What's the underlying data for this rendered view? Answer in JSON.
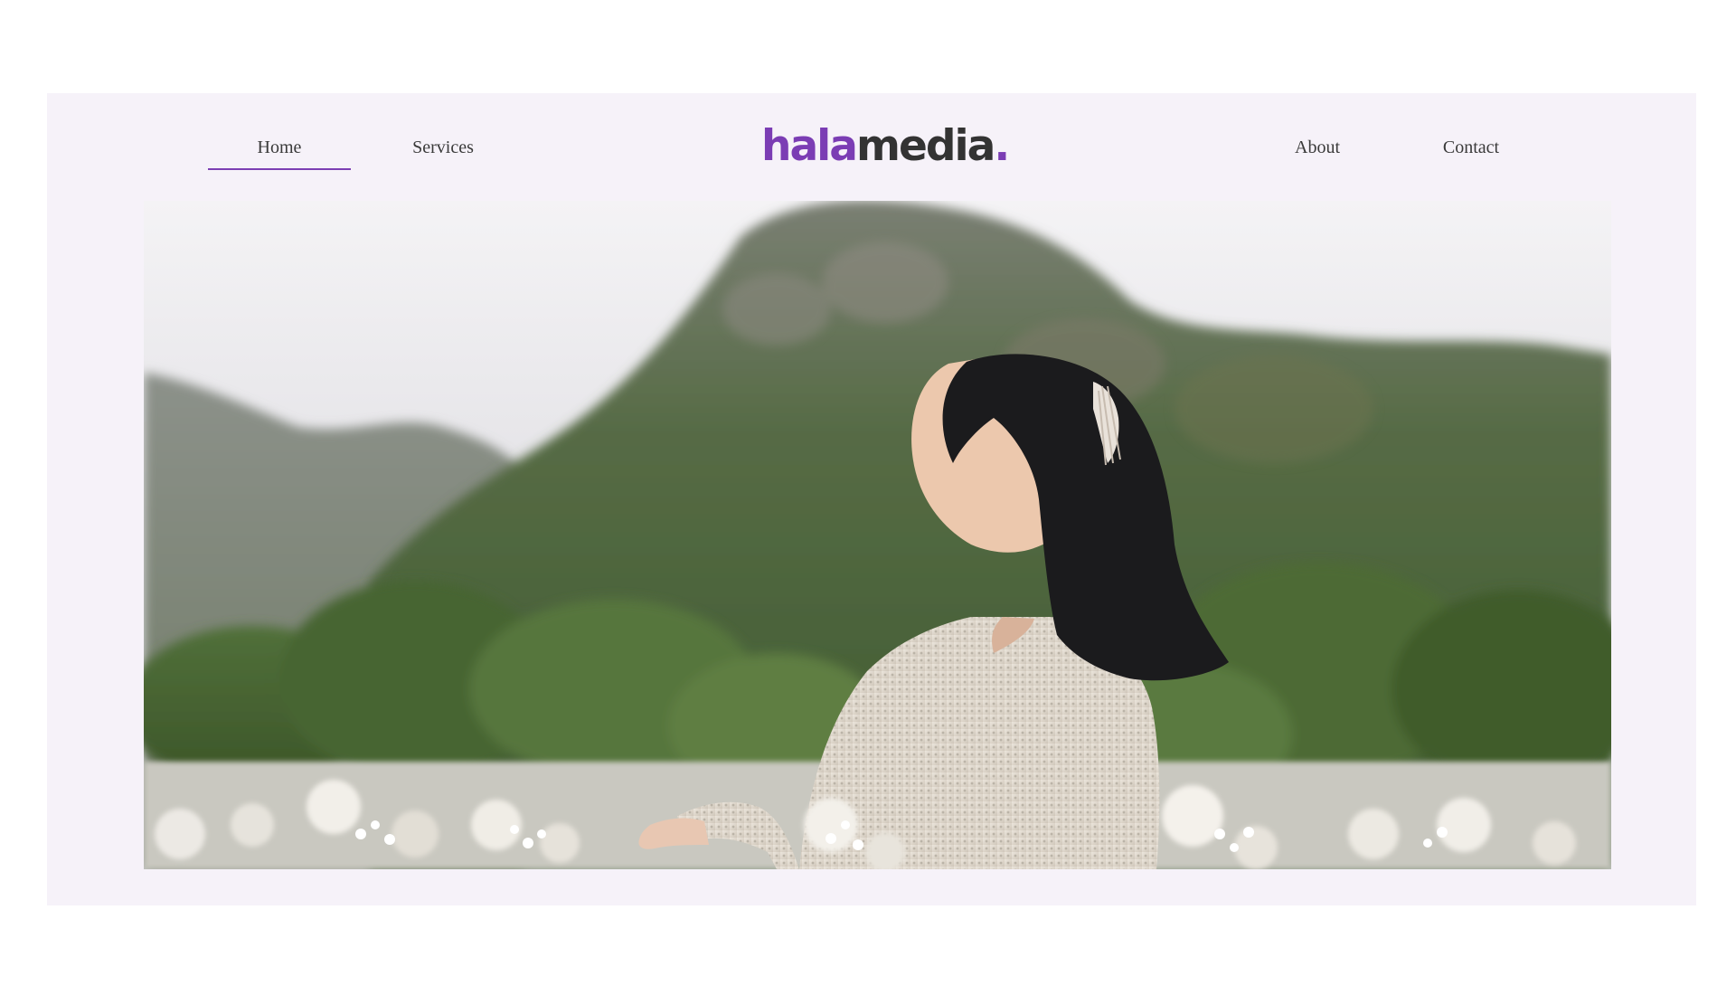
{
  "nav": {
    "left": [
      {
        "label": "Home",
        "active": true
      },
      {
        "label": "Services",
        "active": false
      }
    ],
    "right": [
      {
        "label": "About",
        "active": false
      },
      {
        "label": "Contact",
        "active": false
      }
    ]
  },
  "logo": {
    "part1": "hala",
    "part2": "media",
    "dot": "."
  },
  "colors": {
    "accent": "#7b3db4",
    "frame_bg": "#f6f2f9",
    "text": "#3a3a3a"
  },
  "hero": {
    "image": "woman-in-flower-field-with-mountains"
  }
}
